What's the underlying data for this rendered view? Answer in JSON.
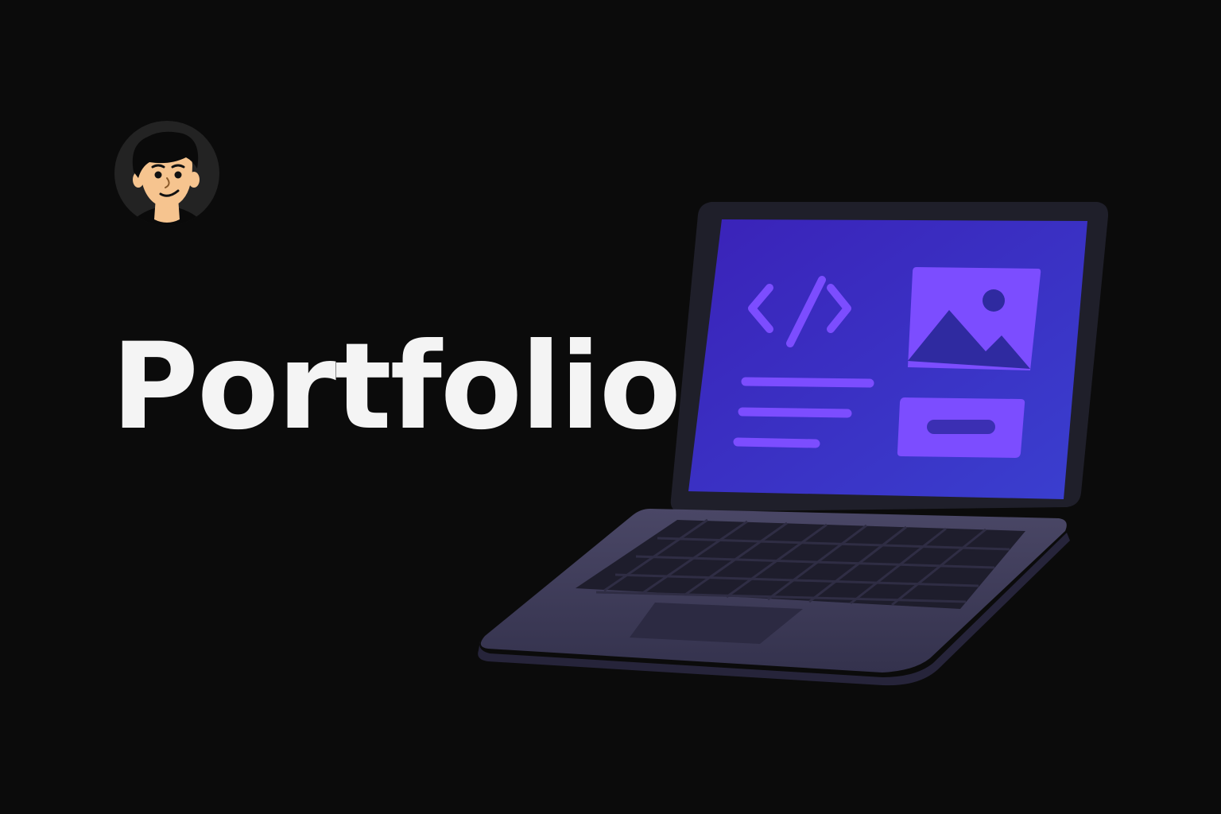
{
  "title": "Portfolio",
  "avatar": {
    "icon": "person-avatar-icon",
    "skin_color": "#f6c48f",
    "hair_color": "#0a0a0a",
    "background_color": "#232323"
  },
  "laptop": {
    "icon": "laptop-illustration",
    "screen_color": "#2f23b8",
    "accent_color": "#7c4dff",
    "body_color": "#3d3a5c",
    "screen_icons": [
      "code-brackets-icon",
      "image-placeholder-icon"
    ]
  },
  "colors": {
    "background": "#0b0b0b",
    "title_text": "#f4f4f4"
  }
}
